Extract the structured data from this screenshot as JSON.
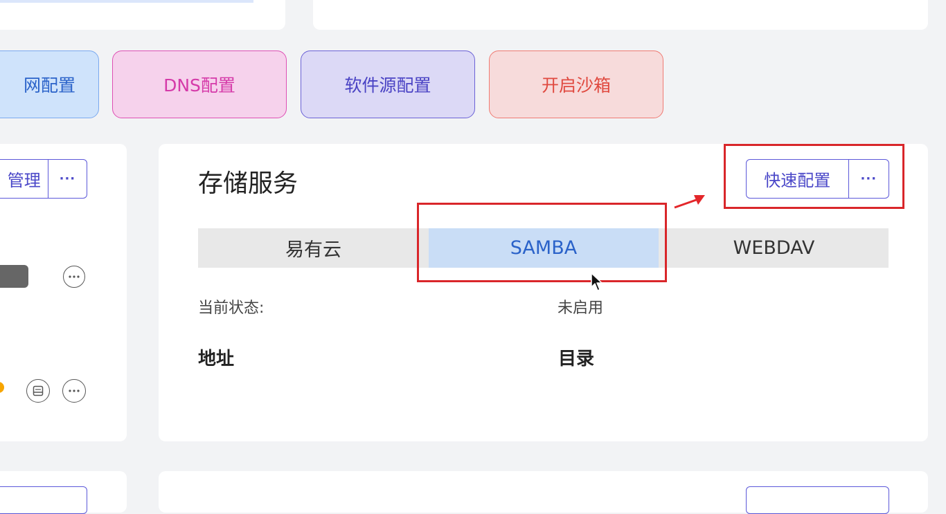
{
  "quick_buttons": [
    {
      "label": "网配置",
      "bg": "#cfe3fb",
      "border": "#7aa9ef",
      "color": "#2a62c9"
    },
    {
      "label": "DNS配置",
      "bg": "#f6d2ec",
      "border": "#de4fb4",
      "color": "#d53aa9"
    },
    {
      "label": "软件源配置",
      "bg": "#dcd9f6",
      "border": "#6a61d6",
      "color": "#4a43c4"
    },
    {
      "label": "开启沙箱",
      "bg": "#f7dbdb",
      "border": "#ef7a72",
      "color": "#e04a40"
    }
  ],
  "left_card": {
    "manage_label": "管理",
    "more_label": "···"
  },
  "storage": {
    "title": "存储服务",
    "quick_config_label": "快速配置",
    "more_label": "···",
    "tabs": [
      "易有云",
      "SAMBA",
      "WEBDAV"
    ],
    "active_tab": 1,
    "status_label": "当前状态:",
    "status_value": "未启用",
    "col_address": "地址",
    "col_directory": "目录"
  },
  "colors": {
    "accent": "#4a47c8",
    "active_tab_bg": "#c9ddf6",
    "tab_bar_bg": "#e8e8e8",
    "annotation_red": "#d9262a"
  }
}
